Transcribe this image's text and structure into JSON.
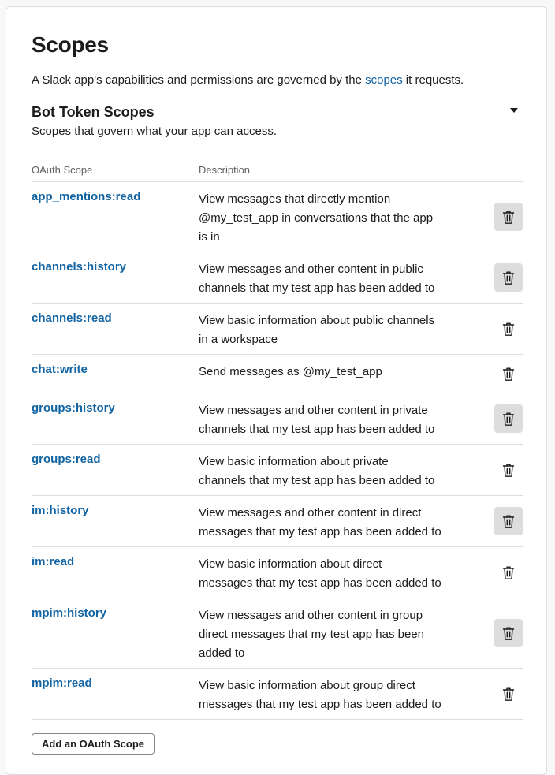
{
  "page": {
    "title": "Scopes",
    "intro_prefix": "A Slack app's capabilities and permissions are governed by the ",
    "intro_link": "scopes",
    "intro_suffix": " it requests."
  },
  "section": {
    "title": "Bot Token Scopes",
    "subtitle": "Scopes that govern what your app can access.",
    "toggle_icon": "caret-down-icon"
  },
  "table": {
    "headers": {
      "scope": "OAuth Scope",
      "description": "Description"
    },
    "rows": [
      {
        "scope": "app_mentions:read",
        "description": [
          "View messages that directly mention",
          "@my_test_app in conversations that the app",
          "is in"
        ],
        "delete_highlighted": true
      },
      {
        "scope": "channels:history",
        "description": [
          "View messages and other content in public",
          "channels that my test app has been added to"
        ],
        "delete_highlighted": true
      },
      {
        "scope": "channels:read",
        "description": [
          "View basic information about public channels",
          "in a workspace"
        ],
        "delete_highlighted": false
      },
      {
        "scope": "chat:write",
        "description": [
          "Send messages as @my_test_app"
        ],
        "delete_highlighted": false
      },
      {
        "scope": "groups:history",
        "description": [
          "View messages and other content in private",
          "channels that my test app has been added to"
        ],
        "delete_highlighted": true
      },
      {
        "scope": "groups:read",
        "description": [
          "View basic information about private",
          "channels that my test app has been added to"
        ],
        "delete_highlighted": false
      },
      {
        "scope": "im:history",
        "description": [
          "View messages and other content in direct",
          "messages that my test app has been added to"
        ],
        "delete_highlighted": true
      },
      {
        "scope": "im:read",
        "description": [
          "View basic information about direct",
          "messages that my test app has been added to"
        ],
        "delete_highlighted": false
      },
      {
        "scope": "mpim:history",
        "description": [
          "View messages and other content in group",
          "direct messages that my test app has been",
          "added to"
        ],
        "delete_highlighted": true
      },
      {
        "scope": "mpim:read",
        "description": [
          "View basic information about group direct",
          "messages that my test app has been added to"
        ],
        "delete_highlighted": false
      }
    ],
    "delete_icon": "trash-icon"
  },
  "actions": {
    "add_scope_label": "Add an OAuth Scope"
  },
  "colors": {
    "link": "#1264a3",
    "text": "#1d1c1d",
    "muted": "#616061",
    "divider": "#dddddd",
    "hover_bg": "#dddddd"
  }
}
